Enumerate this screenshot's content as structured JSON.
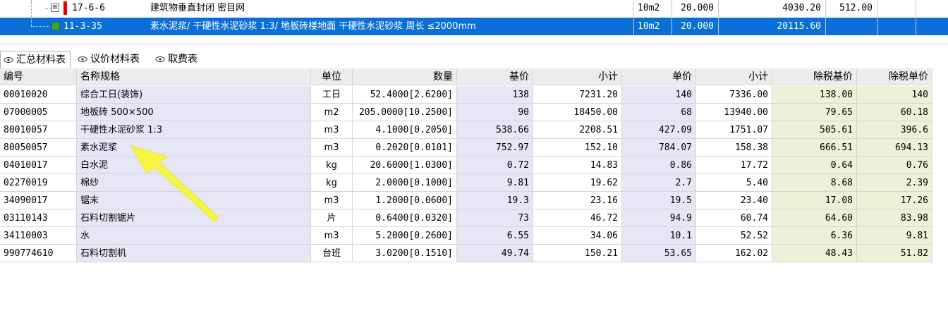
{
  "quota_rows": [
    {
      "code": "17-6-6",
      "name": "建筑物垂直封闭 密目网",
      "unit": "10m2",
      "qty": "20.000",
      "total": "4030.20",
      "extra": "512.00",
      "selected": false
    },
    {
      "code": "11-3-35",
      "name": "素水泥浆/ 干硬性水泥砂浆 1:3/ 地板砖楼地面 干硬性水泥砂浆  周长 ≤2000mm",
      "unit": "10m2",
      "qty": "20.000",
      "total": "20115.60",
      "extra": "",
      "selected": true
    }
  ],
  "tabs": [
    {
      "label": "汇总材料表",
      "active": true
    },
    {
      "label": "议价材料表",
      "active": false
    },
    {
      "label": "取费表",
      "active": false
    }
  ],
  "columns": [
    "编号",
    "名称规格",
    "单位",
    "数量",
    "基价",
    "小计",
    "单价",
    "小计",
    "除税基价",
    "除税单价"
  ],
  "materials": [
    [
      "00010020",
      "综合工日(装饰)",
      "工日",
      "52.4000[2.6200]",
      "138",
      "7231.20",
      "140",
      "7336.00",
      "138.00",
      "140"
    ],
    [
      "07000005",
      "地板砖 500×500",
      "m2",
      "205.0000[10.2500]",
      "90",
      "18450.00",
      "68",
      "13940.00",
      "79.65",
      "60.18"
    ],
    [
      "80010057",
      "干硬性水泥砂浆 1:3",
      "m3",
      "4.1000[0.2050]",
      "538.66",
      "2208.51",
      "427.09",
      "1751.07",
      "505.61",
      "396.6"
    ],
    [
      "80050057",
      "素水泥浆",
      "m3",
      "0.2020[0.0101]",
      "752.97",
      "152.10",
      "784.07",
      "158.38",
      "666.51",
      "694.13"
    ],
    [
      "04010017",
      "白水泥",
      "kg",
      "20.6000[1.0300]",
      "0.72",
      "14.83",
      "0.86",
      "17.72",
      "0.64",
      "0.76"
    ],
    [
      "02270019",
      "棉纱",
      "kg",
      "2.0000[0.1000]",
      "9.81",
      "19.62",
      "2.7",
      "5.40",
      "8.68",
      "2.39"
    ],
    [
      "34090017",
      "锯末",
      "m3",
      "1.2000[0.0600]",
      "19.3",
      "23.16",
      "19.5",
      "23.40",
      "17.08",
      "17.26"
    ],
    [
      "03110143",
      "石料切割锯片",
      "片",
      "0.6400[0.0320]",
      "73",
      "46.72",
      "94.9",
      "60.74",
      "64.60",
      "83.98"
    ],
    [
      "34110003",
      "水",
      "m3",
      "5.2000[0.2600]",
      "6.55",
      "34.06",
      "10.1",
      "52.52",
      "6.36",
      "9.81"
    ],
    [
      "990774610",
      "石料切割机",
      "台班",
      "3.0200[0.1510]",
      "49.74",
      "150.21",
      "53.65",
      "162.02",
      "48.43",
      "51.82"
    ]
  ],
  "colors": {
    "selection": "#0a6fd6",
    "lavender": "#e6e6f7",
    "beige": "#eef0d8",
    "arrow": "#f5f542"
  },
  "icons": [
    "tree-collapse-icon",
    "red-flag-icon",
    "green-item-icon",
    "tab-eye-icon",
    "yellow-arrow-annotation"
  ]
}
